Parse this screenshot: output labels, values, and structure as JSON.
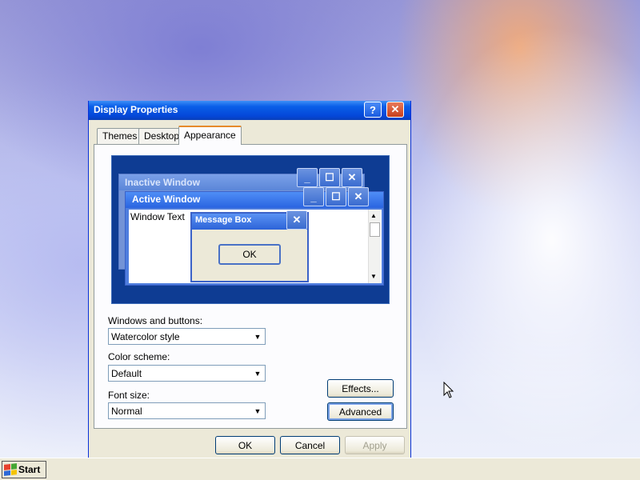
{
  "dialog": {
    "title": "Display Properties",
    "help_glyph": "?",
    "close_glyph": "✕",
    "tabs": [
      {
        "label": "Themes"
      },
      {
        "label": "Desktop"
      },
      {
        "label": "Appearance"
      }
    ],
    "active_tab": "Appearance",
    "preview": {
      "inactive_window_title": "Inactive Window",
      "active_window_title": "Active Window",
      "window_text": "Window Text",
      "message_box_title": "Message Box",
      "ok_label": "OK",
      "minimize_glyph": "_",
      "maximize_glyph": "☐",
      "close_glyph": "✕"
    },
    "windows_and_buttons": {
      "label": "Windows and buttons:",
      "value": "Watercolor style"
    },
    "color_scheme": {
      "label": "Color scheme:",
      "value": "Default"
    },
    "font_size": {
      "label": "Font size:",
      "value": "Normal"
    },
    "effects_button": "Effects...",
    "advanced_button": "Advanced",
    "ok_button": "OK",
    "cancel_button": "Cancel",
    "apply_button": "Apply"
  },
  "taskbar": {
    "start_label": "Start"
  },
  "colors": {
    "title_bar": "#0a5ee8",
    "dialog_bg": "#ece9d8",
    "preview_bg": "#0e3c93"
  }
}
